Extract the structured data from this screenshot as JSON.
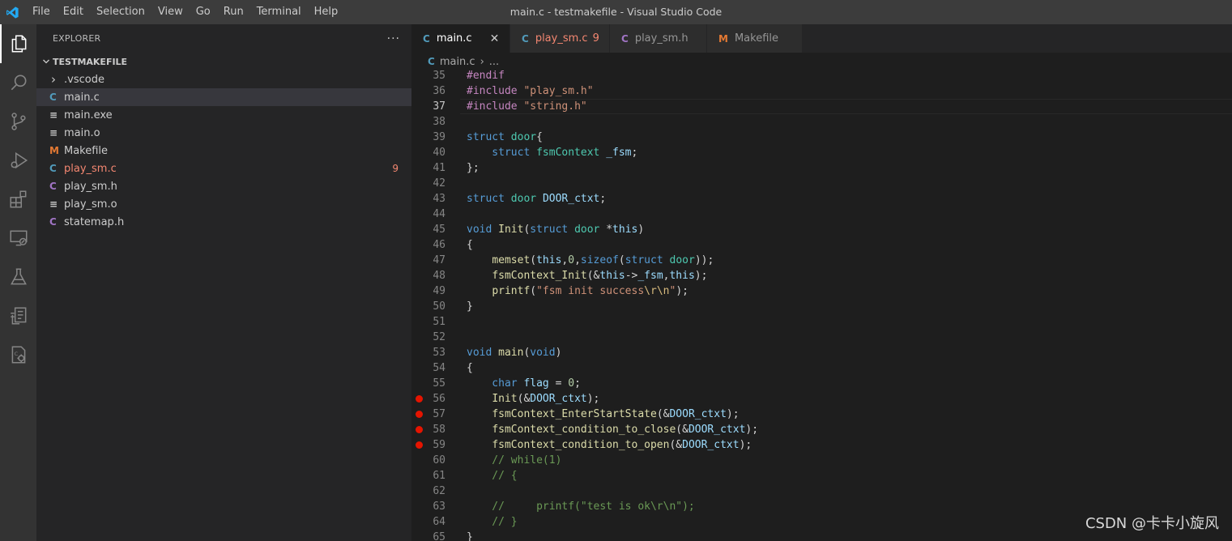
{
  "menu": [
    "File",
    "Edit",
    "Selection",
    "View",
    "Go",
    "Run",
    "Terminal",
    "Help"
  ],
  "window_title": "main.c - testmakefile - Visual Studio Code",
  "activity_icons": [
    "files-icon",
    "search-icon",
    "source-control-icon",
    "run-debug-icon",
    "extensions-icon",
    "remote-explorer-icon",
    "testing-icon",
    "deploy-icon",
    "settings-file-icon"
  ],
  "sidebar": {
    "title": "EXPLORER",
    "more": "···",
    "folder": "TESTMAKEFILE",
    "items": [
      {
        "label": ".vscode",
        "icon": "chevron-right",
        "color": "#cccccc",
        "glyph": "›"
      },
      {
        "label": "main.c",
        "icon": "c-file",
        "color": "#519aba",
        "glyph": "C",
        "selected": true
      },
      {
        "label": "main.exe",
        "icon": "lines-file",
        "color": "#cccccc",
        "glyph": "≡"
      },
      {
        "label": "main.o",
        "icon": "lines-file",
        "color": "#cccccc",
        "glyph": "≡"
      },
      {
        "label": "Makefile",
        "icon": "makefile",
        "color": "#e37933",
        "glyph": "M"
      },
      {
        "label": "play_sm.c",
        "icon": "c-file",
        "color": "#519aba",
        "glyph": "C",
        "badge": "9",
        "error": true
      },
      {
        "label": "play_sm.h",
        "icon": "h-file",
        "color": "#a074c4",
        "glyph": "C"
      },
      {
        "label": "play_sm.o",
        "icon": "lines-file",
        "color": "#cccccc",
        "glyph": "≡"
      },
      {
        "label": "statemap.h",
        "icon": "h-file",
        "color": "#a074c4",
        "glyph": "C"
      }
    ]
  },
  "tabs": [
    {
      "label": "main.c",
      "glyph": "C",
      "color": "#519aba",
      "active": true,
      "close": "✕"
    },
    {
      "label": "play_sm.c",
      "glyph": "C",
      "color": "#519aba",
      "badge": "9",
      "error": true
    },
    {
      "label": "play_sm.h",
      "glyph": "C",
      "color": "#a074c4"
    },
    {
      "label": "Makefile",
      "glyph": "M",
      "color": "#e37933"
    }
  ],
  "breadcrumb": {
    "file": "main.c",
    "sep": "›",
    "rest": "..."
  },
  "current_line": 37,
  "code_lines": [
    {
      "n": "35",
      "t": [
        [
          "#endif",
          "#c586c0"
        ]
      ]
    },
    {
      "n": "36",
      "t": [
        [
          "#include ",
          "#c586c0"
        ],
        [
          "\"play_sm.h\"",
          "#ce9178"
        ]
      ]
    },
    {
      "n": "37",
      "t": [
        [
          "#include ",
          "#c586c0"
        ],
        [
          "\"string.h\"",
          "#ce9178"
        ]
      ]
    },
    {
      "n": "38",
      "t": []
    },
    {
      "n": "39",
      "t": [
        [
          "struct ",
          "#569cd6"
        ],
        [
          "door",
          "#4ec9b0"
        ],
        [
          "{",
          "#d4d4d4"
        ]
      ]
    },
    {
      "n": "40",
      "t": [
        [
          "    struct ",
          "#569cd6"
        ],
        [
          "fsmContext ",
          "#4ec9b0"
        ],
        [
          "_fsm",
          "#9cdcfe"
        ],
        [
          ";",
          "#d4d4d4"
        ]
      ]
    },
    {
      "n": "41",
      "t": [
        [
          "};",
          "#d4d4d4"
        ]
      ]
    },
    {
      "n": "42",
      "t": []
    },
    {
      "n": "43",
      "t": [
        [
          "struct ",
          "#569cd6"
        ],
        [
          "door ",
          "#4ec9b0"
        ],
        [
          "DOOR_ctxt",
          "#9cdcfe"
        ],
        [
          ";",
          "#d4d4d4"
        ]
      ]
    },
    {
      "n": "44",
      "t": []
    },
    {
      "n": "45",
      "t": [
        [
          "void ",
          "#569cd6"
        ],
        [
          "Init",
          "#dcdcaa"
        ],
        [
          "(",
          "#d4d4d4"
        ],
        [
          "struct ",
          "#569cd6"
        ],
        [
          "door ",
          "#4ec9b0"
        ],
        [
          "*",
          "#d4d4d4"
        ],
        [
          "this",
          "#9cdcfe"
        ],
        [
          ")",
          "#d4d4d4"
        ]
      ]
    },
    {
      "n": "46",
      "t": [
        [
          "{",
          "#d4d4d4"
        ]
      ]
    },
    {
      "n": "47",
      "t": [
        [
          "    ",
          "#d4d4d4"
        ],
        [
          "memset",
          "#dcdcaa"
        ],
        [
          "(",
          "#d4d4d4"
        ],
        [
          "this",
          "#9cdcfe"
        ],
        [
          ",",
          "#d4d4d4"
        ],
        [
          "0",
          "#b5cea8"
        ],
        [
          ",",
          "#d4d4d4"
        ],
        [
          "sizeof",
          "#569cd6"
        ],
        [
          "(",
          "#d4d4d4"
        ],
        [
          "struct ",
          "#569cd6"
        ],
        [
          "door",
          "#4ec9b0"
        ],
        [
          "));",
          "#d4d4d4"
        ]
      ]
    },
    {
      "n": "48",
      "t": [
        [
          "    ",
          "#d4d4d4"
        ],
        [
          "fsmContext_Init",
          "#dcdcaa"
        ],
        [
          "(&",
          "#d4d4d4"
        ],
        [
          "this",
          "#9cdcfe"
        ],
        [
          "->",
          "#d4d4d4"
        ],
        [
          "_fsm",
          "#9cdcfe"
        ],
        [
          ",",
          "#d4d4d4"
        ],
        [
          "this",
          "#9cdcfe"
        ],
        [
          ");",
          "#d4d4d4"
        ]
      ]
    },
    {
      "n": "49",
      "t": [
        [
          "    ",
          "#d4d4d4"
        ],
        [
          "printf",
          "#dcdcaa"
        ],
        [
          "(",
          "#d4d4d4"
        ],
        [
          "\"fsm init success",
          "#ce9178"
        ],
        [
          "\\r\\n",
          "#d7ba7d"
        ],
        [
          "\"",
          "#ce9178"
        ],
        [
          ");",
          "#d4d4d4"
        ]
      ]
    },
    {
      "n": "50",
      "t": [
        [
          "}",
          "#d4d4d4"
        ]
      ]
    },
    {
      "n": "51",
      "t": []
    },
    {
      "n": "52",
      "t": []
    },
    {
      "n": "53",
      "t": [
        [
          "void ",
          "#569cd6"
        ],
        [
          "main",
          "#dcdcaa"
        ],
        [
          "(",
          "#d4d4d4"
        ],
        [
          "void",
          "#569cd6"
        ],
        [
          ")",
          "#d4d4d4"
        ]
      ]
    },
    {
      "n": "54",
      "t": [
        [
          "{",
          "#d4d4d4"
        ]
      ]
    },
    {
      "n": "55",
      "t": [
        [
          "    char ",
          "#569cd6"
        ],
        [
          "flag",
          "#9cdcfe"
        ],
        [
          " = ",
          "#d4d4d4"
        ],
        [
          "0",
          "#b5cea8"
        ],
        [
          ";",
          "#d4d4d4"
        ]
      ]
    },
    {
      "n": "56",
      "bp": true,
      "t": [
        [
          "    ",
          "#d4d4d4"
        ],
        [
          "Init",
          "#dcdcaa"
        ],
        [
          "(&",
          "#d4d4d4"
        ],
        [
          "DOOR_ctxt",
          "#9cdcfe"
        ],
        [
          ");",
          "#d4d4d4"
        ]
      ]
    },
    {
      "n": "57",
      "bp": true,
      "t": [
        [
          "    ",
          "#d4d4d4"
        ],
        [
          "fsmContext_EnterStartState",
          "#dcdcaa"
        ],
        [
          "(&",
          "#d4d4d4"
        ],
        [
          "DOOR_ctxt",
          "#9cdcfe"
        ],
        [
          ");",
          "#d4d4d4"
        ]
      ]
    },
    {
      "n": "58",
      "bp": true,
      "t": [
        [
          "    ",
          "#d4d4d4"
        ],
        [
          "fsmContext_condition_to_close",
          "#dcdcaa"
        ],
        [
          "(&",
          "#d4d4d4"
        ],
        [
          "DOOR_ctxt",
          "#9cdcfe"
        ],
        [
          ");",
          "#d4d4d4"
        ]
      ]
    },
    {
      "n": "59",
      "bp": true,
      "t": [
        [
          "    ",
          "#d4d4d4"
        ],
        [
          "fsmContext_condition_to_open",
          "#dcdcaa"
        ],
        [
          "(&",
          "#d4d4d4"
        ],
        [
          "DOOR_ctxt",
          "#9cdcfe"
        ],
        [
          ");",
          "#d4d4d4"
        ]
      ]
    },
    {
      "n": "60",
      "t": [
        [
          "    // while(1)",
          "#6a9955"
        ]
      ]
    },
    {
      "n": "61",
      "t": [
        [
          "    // {",
          "#6a9955"
        ]
      ]
    },
    {
      "n": "62",
      "t": []
    },
    {
      "n": "63",
      "t": [
        [
          "    //     printf(\"test is ok\\r\\n\");",
          "#6a9955"
        ]
      ]
    },
    {
      "n": "64",
      "t": [
        [
          "    // }",
          "#6a9955"
        ]
      ]
    },
    {
      "n": "65",
      "t": [
        [
          "}",
          "#d4d4d4"
        ]
      ]
    }
  ],
  "watermark": "CSDN @卡卡小旋风"
}
